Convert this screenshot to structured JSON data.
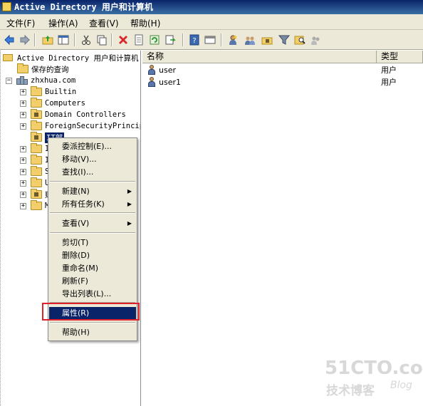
{
  "window": {
    "title": "Active Directory 用户和计算机"
  },
  "menubar": {
    "items": [
      "文件(F)",
      "操作(A)",
      "查看(V)",
      "帮助(H)"
    ]
  },
  "toolbar": {
    "icons": [
      "back-icon",
      "forward-icon",
      "up-folder-icon",
      "show-hide-tree-icon",
      "cut-icon",
      "copy-icon",
      "delete-icon",
      "properties-icon",
      "refresh-icon",
      "export-icon",
      "help-icon",
      "view-icon",
      "add-user-icon",
      "add-group-icon",
      "add-ou-icon",
      "filter-icon",
      "find-icon",
      "add-to-group-icon"
    ]
  },
  "tree": {
    "root": "Active Directory 用户和计算机",
    "saved_queries": "保存的查询",
    "domain": "zhxhua.com",
    "items": [
      {
        "label": "Builtin",
        "type": "folder"
      },
      {
        "label": "Computers",
        "type": "folder"
      },
      {
        "label": "Domain Controllers",
        "type": "ou"
      },
      {
        "label": "ForeignSecurityPrincip",
        "type": "folder"
      },
      {
        "label": "IT部",
        "type": "ou",
        "selected": true
      },
      {
        "label": "I",
        "type": "folder"
      },
      {
        "label": "I",
        "type": "folder"
      },
      {
        "label": "S",
        "type": "folder"
      },
      {
        "label": "U",
        "type": "folder"
      },
      {
        "label": "财",
        "type": "ou"
      },
      {
        "label": "M",
        "type": "folder"
      }
    ]
  },
  "list": {
    "columns": [
      "名称",
      "类型"
    ],
    "rows": [
      {
        "name": "user",
        "type": "用户"
      },
      {
        "name": "user1",
        "type": "用户"
      }
    ]
  },
  "context_menu": {
    "group1": [
      "委派控制(E)...",
      "移动(V)...",
      "查找(I)..."
    ],
    "group2": [
      "新建(N)",
      "所有任务(K)"
    ],
    "group3": [
      "查看(V)"
    ],
    "group4": [
      "剪切(T)",
      "删除(D)",
      "重命名(M)",
      "刷新(F)",
      "导出列表(L)..."
    ],
    "group5": [
      "属性(R)"
    ],
    "group6": [
      "帮助(H)"
    ],
    "highlighted": "属性(R)"
  },
  "watermark": {
    "line1": "51CTO.com",
    "line2": "技术博客",
    "line3": "Blog"
  },
  "colors": {
    "titlebar": "#0a246a",
    "selection": "#0a246a",
    "highlight_box": "#e0202a",
    "menu_bg": "#ece9d8"
  }
}
